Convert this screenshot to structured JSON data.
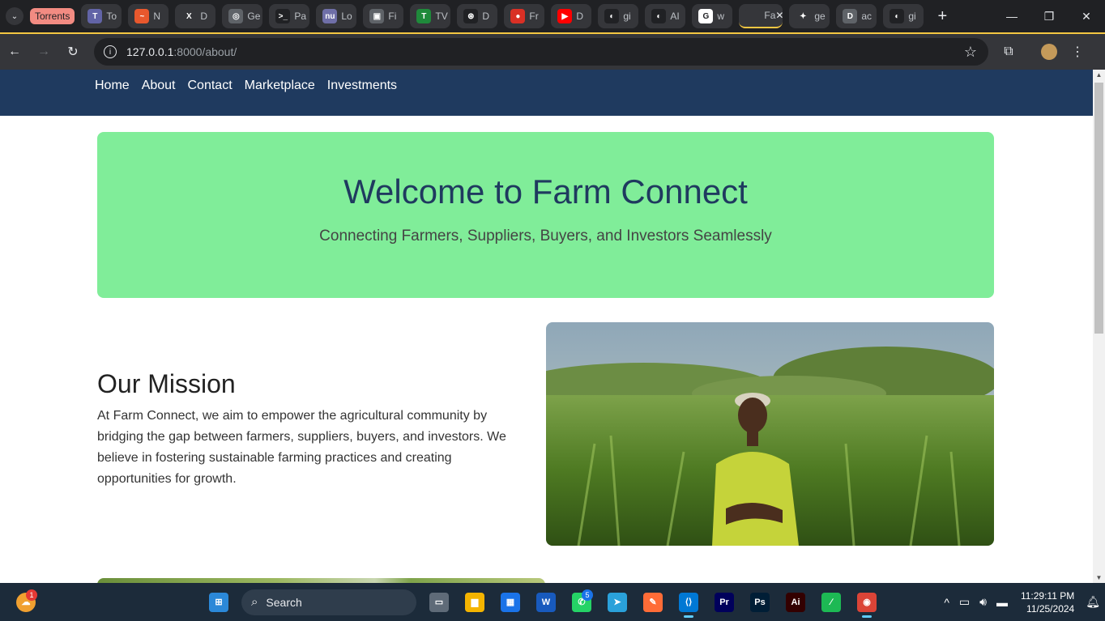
{
  "browser": {
    "tab_group": "Torrents",
    "tabs": [
      {
        "label": "To",
        "color": "#6264a7",
        "glyph": "T"
      },
      {
        "label": "N",
        "color": "#e8582d",
        "glyph": "~"
      },
      {
        "label": "D",
        "color": "#35363a",
        "glyph": "X"
      },
      {
        "label": "Ge",
        "color": "#5f6368",
        "glyph": "◎"
      },
      {
        "label": "Pa",
        "color": "#202124",
        "glyph": ">_"
      },
      {
        "label": "Lo",
        "color": "#6f6fa8",
        "glyph": "nu"
      },
      {
        "label": "Fi",
        "color": "#5f6368",
        "glyph": "▣"
      },
      {
        "label": "TV",
        "color": "#1f8a3b",
        "glyph": "T"
      },
      {
        "label": "D",
        "color": "#202124",
        "glyph": "⊛"
      },
      {
        "label": "Fr",
        "color": "#d93025",
        "glyph": "●"
      },
      {
        "label": "D",
        "color": "#ff0000",
        "glyph": "▶"
      },
      {
        "label": "gi",
        "color": "#202124",
        "glyph": "◐"
      },
      {
        "label": "AI",
        "color": "#202124",
        "glyph": "◐"
      },
      {
        "label": "w",
        "color": "#ffffff",
        "glyph": "G"
      },
      {
        "label": "Fa",
        "color": "#35363a",
        "glyph": "",
        "active": true
      },
      {
        "label": "ge",
        "color": "#35363a",
        "glyph": "✦"
      },
      {
        "label": "ac",
        "color": "#5f6368",
        "glyph": "D"
      },
      {
        "label": "gi",
        "color": "#202124",
        "glyph": "◐"
      }
    ],
    "url_host": "127.0.0.1",
    "url_path": ":8000/about/"
  },
  "site": {
    "nav": [
      "Home",
      "About",
      "Contact",
      "Marketplace",
      "Investments"
    ],
    "hero_title": "Welcome to Farm Connect",
    "hero_subtitle": "Connecting Farmers, Suppliers, Buyers, and Investors Seamlessly",
    "mission_title": "Our Mission",
    "mission_text": "At Farm Connect, we aim to empower the agricultural community by bridging the gap between farmers, suppliers, buyers, and investors. We believe in fostering sustainable farming practices and creating opportunities for growth.",
    "accent_color": "#80ed99",
    "nav_color": "#1f3a5f"
  },
  "taskbar": {
    "search_placeholder": "Search",
    "weather_badge": "1",
    "whatsapp_badge": "5",
    "apps": [
      {
        "name": "file-explorer-icon",
        "glyph": "▆",
        "color": "#f4b400"
      },
      {
        "name": "store-icon",
        "glyph": "▦",
        "color": "#1a73e8"
      },
      {
        "name": "word-icon",
        "glyph": "W",
        "color": "#185abd"
      },
      {
        "name": "whatsapp-icon",
        "glyph": "✆",
        "color": "#25d366"
      },
      {
        "name": "telegram-icon",
        "glyph": "➤",
        "color": "#2aa1da"
      },
      {
        "name": "postman-icon",
        "glyph": "✎",
        "color": "#ff6c37"
      },
      {
        "name": "vscode-icon",
        "glyph": "⟨⟩",
        "color": "#0078d4"
      },
      {
        "name": "premiere-icon",
        "glyph": "Pr",
        "color": "#00005b"
      },
      {
        "name": "photoshop-icon",
        "glyph": "Ps",
        "color": "#001e36"
      },
      {
        "name": "illustrator-icon",
        "glyph": "Ai",
        "color": "#330000"
      },
      {
        "name": "app-icon",
        "glyph": "∕",
        "color": "#1db954"
      },
      {
        "name": "chrome-icon",
        "glyph": "◉",
        "color": "#db4437"
      }
    ],
    "time": "11:29:11 PM",
    "date": "11/25/2024"
  }
}
